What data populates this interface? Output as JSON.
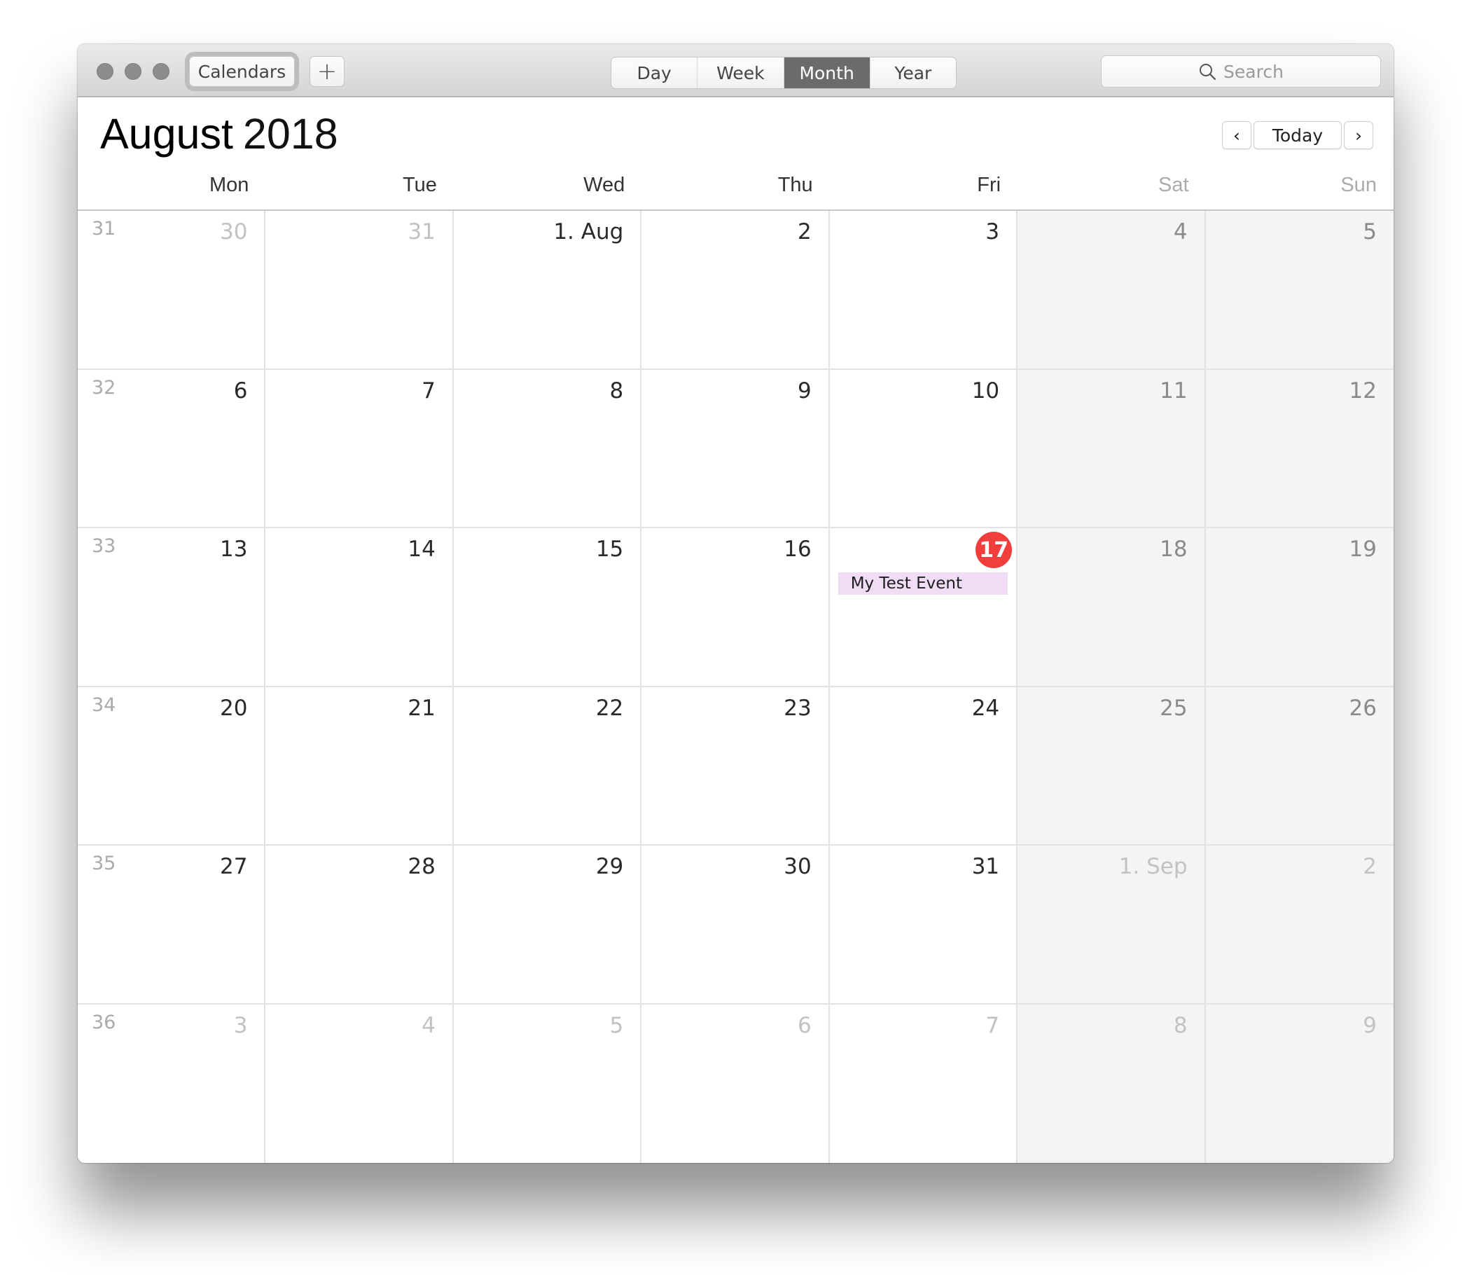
{
  "toolbar": {
    "window_controls": [
      "close",
      "minimize",
      "zoom"
    ],
    "calendars_label": "Calendars",
    "add_label": "+",
    "views": [
      {
        "label": "Day",
        "active": false
      },
      {
        "label": "Week",
        "active": false
      },
      {
        "label": "Month",
        "active": true
      },
      {
        "label": "Year",
        "active": false
      }
    ],
    "search_placeholder": "Search",
    "search_icon": "search-icon"
  },
  "header": {
    "month": "August",
    "year": "2018",
    "prev_icon": "‹",
    "today_label": "Today",
    "next_icon": "›"
  },
  "weekdays": [
    {
      "label": "Mon",
      "weekend": false
    },
    {
      "label": "Tue",
      "weekend": false
    },
    {
      "label": "Wed",
      "weekend": false
    },
    {
      "label": "Thu",
      "weekend": false
    },
    {
      "label": "Fri",
      "weekend": false
    },
    {
      "label": "Sat",
      "weekend": true
    },
    {
      "label": "Sun",
      "weekend": true
    }
  ],
  "today": {
    "day": "17",
    "accent": "#f23d3d"
  },
  "weeks": [
    {
      "week": "31",
      "days": [
        {
          "label": "30",
          "other": true
        },
        {
          "label": "31",
          "other": true
        },
        {
          "label": "1. Aug"
        },
        {
          "label": "2"
        },
        {
          "label": "3"
        },
        {
          "label": "4"
        },
        {
          "label": "5"
        }
      ]
    },
    {
      "week": "32",
      "days": [
        {
          "label": "6"
        },
        {
          "label": "7"
        },
        {
          "label": "8"
        },
        {
          "label": "9"
        },
        {
          "label": "10"
        },
        {
          "label": "11"
        },
        {
          "label": "12"
        }
      ]
    },
    {
      "week": "33",
      "days": [
        {
          "label": "13"
        },
        {
          "label": "14"
        },
        {
          "label": "15"
        },
        {
          "label": "16"
        },
        {
          "label": "17",
          "today": true,
          "events": [
            {
              "title": "My Test Event",
              "color": "#f0ddf5"
            }
          ]
        },
        {
          "label": "18"
        },
        {
          "label": "19"
        }
      ]
    },
    {
      "week": "34",
      "days": [
        {
          "label": "20"
        },
        {
          "label": "21"
        },
        {
          "label": "22"
        },
        {
          "label": "23"
        },
        {
          "label": "24"
        },
        {
          "label": "25"
        },
        {
          "label": "26"
        }
      ]
    },
    {
      "week": "35",
      "days": [
        {
          "label": "27"
        },
        {
          "label": "28"
        },
        {
          "label": "29"
        },
        {
          "label": "30"
        },
        {
          "label": "31"
        },
        {
          "label": "1. Sep",
          "other": true
        },
        {
          "label": "2",
          "other": true
        }
      ]
    },
    {
      "week": "36",
      "days": [
        {
          "label": "3",
          "other": true
        },
        {
          "label": "4",
          "other": true
        },
        {
          "label": "5",
          "other": true
        },
        {
          "label": "6",
          "other": true
        },
        {
          "label": "7",
          "other": true
        },
        {
          "label": "8",
          "other": true
        },
        {
          "label": "9",
          "other": true
        }
      ]
    }
  ]
}
